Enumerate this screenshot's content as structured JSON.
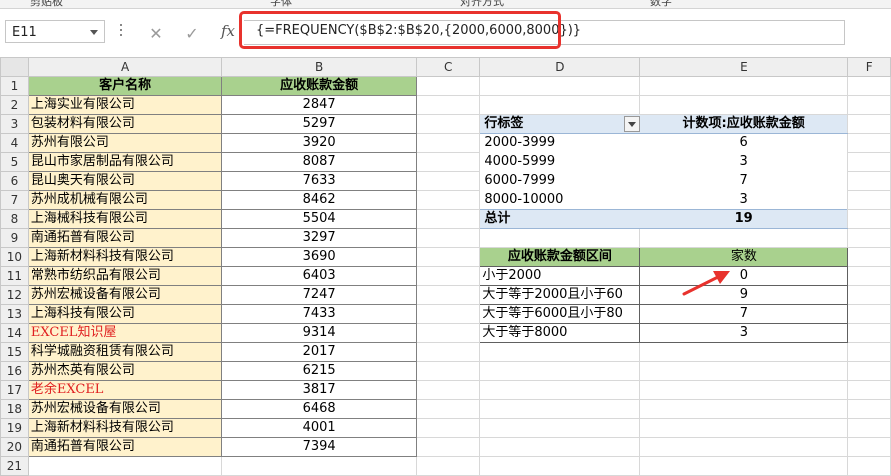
{
  "ribbon": {
    "labels": [
      "剪贴板",
      "字体",
      "对齐方式",
      "数字"
    ]
  },
  "formula_bar": {
    "name_box": "E11",
    "cancel_icon": "✕",
    "enter_icon": "✓",
    "fx_label": "fx",
    "formula": "{=FREQUENCY($B$2:$B$20,{2000,6000,8000})}"
  },
  "columns": [
    "A",
    "B",
    "C",
    "D",
    "E",
    "F"
  ],
  "rows": [
    "1",
    "2",
    "3",
    "4",
    "5",
    "6",
    "7",
    "8",
    "9",
    "10",
    "11",
    "12",
    "13",
    "14",
    "15",
    "16",
    "17",
    "18",
    "19",
    "20",
    "21"
  ],
  "customer_table": {
    "header_name": "客户名称",
    "header_amount": "应收账款金额",
    "rows": [
      {
        "name": "上海实业有限公司",
        "amount": "2847"
      },
      {
        "name": "包装材料有限公司",
        "amount": "5297"
      },
      {
        "name": "苏州有限公司",
        "amount": "3920"
      },
      {
        "name": "昆山市家居制品有限公司",
        "amount": "8087"
      },
      {
        "name": "昆山奥天有限公司",
        "amount": "7633"
      },
      {
        "name": "苏州成机械有限公司",
        "amount": "8462"
      },
      {
        "name": "上海械科技有限公司",
        "amount": "5504"
      },
      {
        "name": "南通拓普有限公司",
        "amount": "3297"
      },
      {
        "name": "上海新材料科技有限公司",
        "amount": "3690"
      },
      {
        "name": "常熟市纺织品有限公司",
        "amount": "6403"
      },
      {
        "name": "苏州宏械设备有限公司",
        "amount": "7247"
      },
      {
        "name": "上海科技有限公司",
        "amount": "7433"
      },
      {
        "name": "EXCEL知识屋",
        "amount": "9314"
      },
      {
        "name": "科学城融资租赁有限公司",
        "amount": "2017"
      },
      {
        "name": "苏州杰英有限公司",
        "amount": "6215"
      },
      {
        "name": "老余EXCEL",
        "amount": "3817"
      },
      {
        "name": "苏州宏械设备有限公司",
        "amount": "6468"
      },
      {
        "name": "上海新材料科技有限公司",
        "amount": "4001"
      },
      {
        "name": "南通拓普有限公司",
        "amount": "7394"
      }
    ]
  },
  "pivot_table": {
    "header_label": "行标签",
    "header_value": "计数项:应收账款金额",
    "rows": [
      {
        "label": "2000-3999",
        "value": "6"
      },
      {
        "label": "4000-5999",
        "value": "3"
      },
      {
        "label": "6000-7999",
        "value": "7"
      },
      {
        "label": "8000-10000",
        "value": "3"
      }
    ],
    "total_label": "总计",
    "total_value": "19"
  },
  "frequency_table": {
    "header_interval": "应收账款金额区间",
    "header_count": "家数",
    "rows": [
      {
        "interval": "小于2000",
        "count": "0"
      },
      {
        "interval": "大于等于2000且小于60",
        "count": "9"
      },
      {
        "interval": "大于等于6000且小于80",
        "count": "7"
      },
      {
        "interval": "大于等于8000",
        "count": "3"
      }
    ]
  },
  "colors": {
    "header_green": "#a9d18e",
    "name_fill": "#fff2cc",
    "pivot_blue": "#dde8f4",
    "highlight_red": "#e8322d"
  }
}
